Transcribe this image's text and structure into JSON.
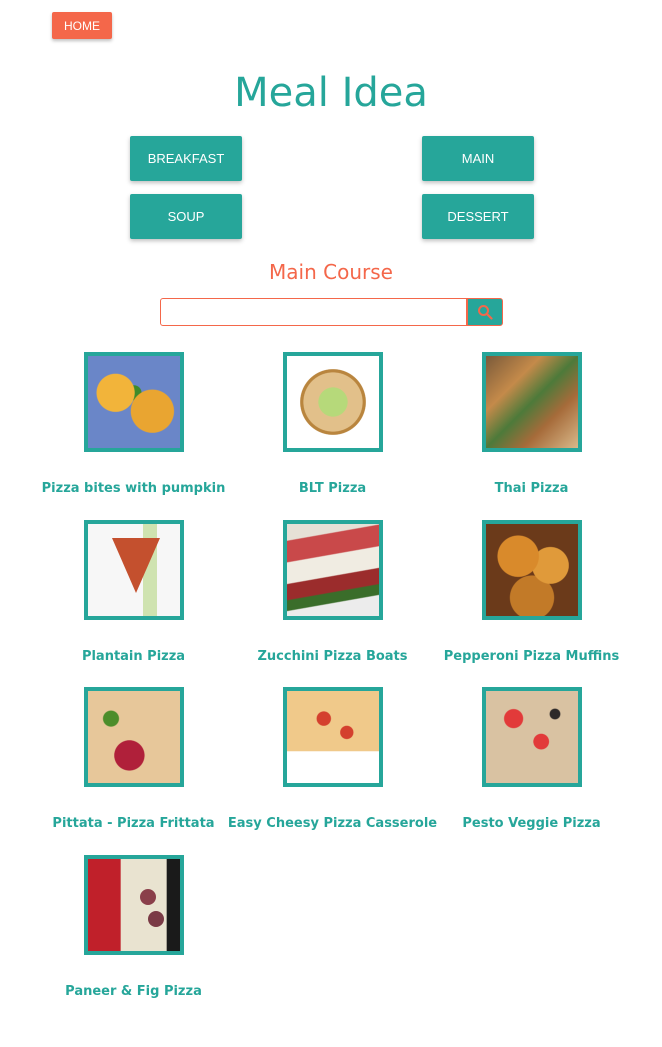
{
  "nav": {
    "home_label": "HOME"
  },
  "page": {
    "title": "Meal Idea",
    "section_title": "Main Course"
  },
  "categories": [
    {
      "label": "BREAKFAST"
    },
    {
      "label": "MAIN"
    },
    {
      "label": "SOUP"
    },
    {
      "label": "DESSERT"
    }
  ],
  "search": {
    "value": "",
    "placeholder": "",
    "icon": "search-icon"
  },
  "colors": {
    "accent": "#26a69a",
    "brand": "#f4674a"
  },
  "recipes": [
    {
      "name": "Pizza bites with pumpkin"
    },
    {
      "name": "BLT Pizza"
    },
    {
      "name": "Thai Pizza"
    },
    {
      "name": "Plantain Pizza"
    },
    {
      "name": "Zucchini Pizza Boats"
    },
    {
      "name": "Pepperoni Pizza Muffins"
    },
    {
      "name": "Pittata - Pizza Frittata"
    },
    {
      "name": "Easy Cheesy Pizza Casserole"
    },
    {
      "name": "Pesto Veggie Pizza"
    },
    {
      "name": "Paneer & Fig Pizza"
    }
  ]
}
